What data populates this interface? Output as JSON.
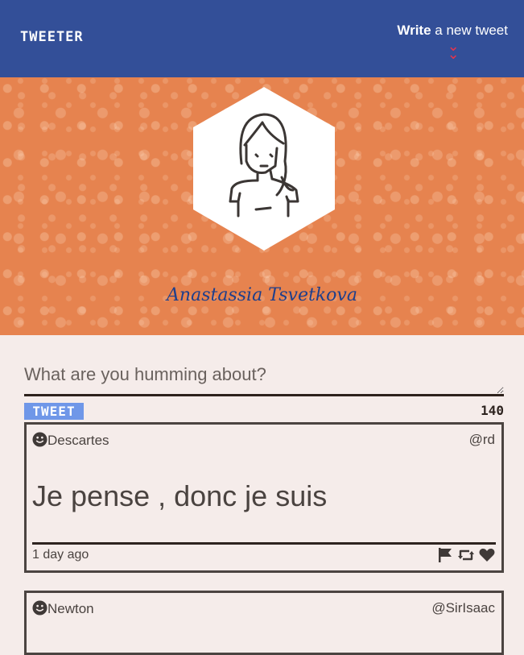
{
  "header": {
    "brand": "TWEETER",
    "compose_toggle": {
      "strong": "Write",
      "rest": " a new tweet"
    }
  },
  "profile": {
    "name": "Anastassia Tsvetkova"
  },
  "compose": {
    "placeholder": "What are you humming about?",
    "button_label": "TWEET",
    "char_count": "140"
  },
  "tweets": [
    {
      "author": "Descartes",
      "handle": "@rd",
      "text": "Je pense , donc je suis",
      "age": "1 day ago"
    },
    {
      "author": "Newton",
      "handle": "@SirIsaac"
    }
  ],
  "icons": {
    "compose_toggle": "double-chevron-down-icon",
    "author": "smiley-icon",
    "actions": [
      "flag-icon",
      "retweet-icon",
      "heart-icon"
    ]
  },
  "colors": {
    "header": "#334f98",
    "banner": "#e6834f",
    "button": "#6f97e8",
    "chevron": "#e8334a",
    "name": "#1e3f8c"
  }
}
